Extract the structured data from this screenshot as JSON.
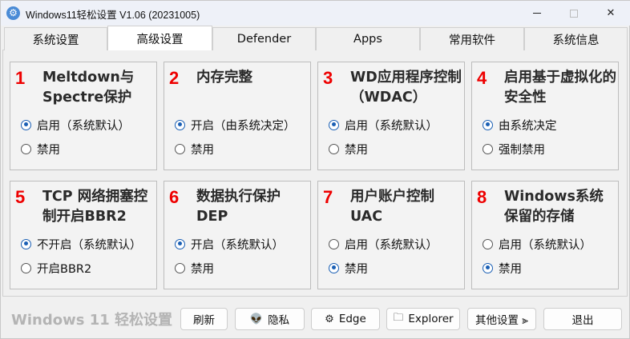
{
  "window": {
    "title": "Windows11轻松设置 V1.06 (20231005)",
    "icon": "gear-icon",
    "controls": [
      "minimize-icon",
      "maximize-icon",
      "close-icon"
    ],
    "close_glyph": "✕"
  },
  "tabs": [
    {
      "label": "系统设置",
      "active": false
    },
    {
      "label": "高级设置",
      "active": true
    },
    {
      "label": "Defender",
      "active": false
    },
    {
      "label": "Apps",
      "active": false
    },
    {
      "label": "常用软件",
      "active": false
    },
    {
      "label": "系统信息",
      "active": false
    }
  ],
  "cards": [
    {
      "num": "1",
      "title": "Meltdown与Spectre保护",
      "options": [
        {
          "label": "启用（系统默认）",
          "selected": true
        },
        {
          "label": "禁用",
          "selected": false
        }
      ]
    },
    {
      "num": "2",
      "title": "内存完整",
      "options": [
        {
          "label": "开启（由系统决定）",
          "selected": true
        },
        {
          "label": "禁用",
          "selected": false
        }
      ]
    },
    {
      "num": "3",
      "title": "WD应用程序控制（WDAC）",
      "options": [
        {
          "label": "启用（系统默认）",
          "selected": true
        },
        {
          "label": "禁用",
          "selected": false
        }
      ]
    },
    {
      "num": "4",
      "title": "启用基于虚拟化的安全性",
      "options": [
        {
          "label": "由系统决定",
          "selected": true
        },
        {
          "label": "强制禁用",
          "selected": false
        }
      ]
    },
    {
      "num": "5",
      "title": "TCP 网络拥塞控制开启BBR2",
      "options": [
        {
          "label": "不开启（系统默认）",
          "selected": true
        },
        {
          "label": "开启BBR2",
          "selected": false
        }
      ]
    },
    {
      "num": "6",
      "title": "数据执行保护DEP",
      "options": [
        {
          "label": "开启（系统默认）",
          "selected": true
        },
        {
          "label": "禁用",
          "selected": false
        }
      ]
    },
    {
      "num": "7",
      "title": "用户账户控制UAC",
      "options": [
        {
          "label": "启用（系统默认）",
          "selected": false
        },
        {
          "label": "禁用",
          "selected": true
        }
      ]
    },
    {
      "num": "8",
      "title": "Windows系统保留的存储",
      "options": [
        {
          "label": "启用（系统默认）",
          "selected": false
        },
        {
          "label": "禁用",
          "selected": true
        }
      ]
    }
  ],
  "footer": {
    "brand": "Windows 11 轻松设置",
    "buttons": [
      {
        "label": "刷新",
        "icon": ""
      },
      {
        "label": "隐私",
        "icon": "alien-icon",
        "glyph": "👽"
      },
      {
        "label": "Edge",
        "icon": "gear-icon",
        "glyph": "⚙"
      },
      {
        "label": "Explorer",
        "icon": "folder-icon",
        "glyph": "🗀"
      },
      {
        "label": "其他设置 ⫸",
        "icon": ""
      },
      {
        "label": "退出",
        "icon": ""
      }
    ]
  },
  "colors": {
    "accent": "#1a5fb4",
    "number_red": "#ee0000",
    "title_bar": "#eef1f8"
  }
}
